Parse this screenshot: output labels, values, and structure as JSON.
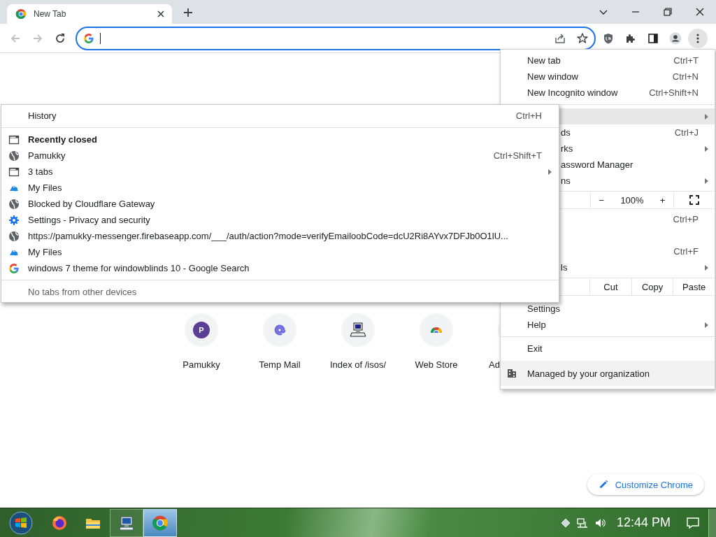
{
  "tab_strip": {
    "tabs": [
      {
        "title": "New Tab",
        "selected": true
      }
    ]
  },
  "toolbar": {
    "nav_buttons": [
      {
        "kind": "back",
        "disabled": true
      },
      {
        "kind": "forward",
        "disabled": true
      },
      {
        "kind": "reload",
        "disabled": false
      }
    ],
    "omnibox": {
      "focused": true
    },
    "actions": [
      {
        "kind": "shield",
        "pressed": false
      },
      {
        "kind": "puzzle",
        "pressed": false
      },
      {
        "kind": "side_panel",
        "pressed": false
      },
      {
        "kind": "profile",
        "pressed": false
      },
      {
        "kind": "menu",
        "pressed": true
      }
    ]
  },
  "shortcuts": [
    {
      "title": "Pamukky",
      "kind": "letter",
      "initial": "P"
    },
    {
      "title": "Temp Mail",
      "kind": "at"
    },
    {
      "title": "Index of /isos/",
      "kind": "computer"
    },
    {
      "title": "Web Store",
      "kind": "store"
    },
    {
      "title": "Ad",
      "kind": "covered"
    }
  ],
  "customize_button": {
    "label": "Customize Chrome"
  },
  "main_menu": {
    "items": [
      {
        "kind": "item",
        "label": "New tab",
        "shortcut": "Ctrl+T"
      },
      {
        "kind": "item",
        "label": "New window",
        "shortcut": "Ctrl+N"
      },
      {
        "kind": "item",
        "label": "New Incognito window",
        "shortcut": "Ctrl+Shift+N"
      },
      {
        "kind": "separator"
      },
      {
        "kind": "item",
        "submenu": true,
        "highlighted": true
      },
      {
        "kind": "item",
        "label": "ds",
        "partly_hidden": true,
        "shortcut": "Ctrl+J"
      },
      {
        "kind": "item",
        "label": "rks",
        "partly_hidden": true,
        "submenu": true
      },
      {
        "kind": "item",
        "label": "assword Manager",
        "partly_hidden": true
      },
      {
        "kind": "item",
        "label": "ns",
        "partly_hidden": true,
        "submenu": true
      },
      {
        "kind": "zoom",
        "minus": "−",
        "value": "100%",
        "plus": "+"
      },
      {
        "kind": "item",
        "shortcut": "Ctrl+P"
      },
      {
        "kind": "item"
      },
      {
        "kind": "item",
        "shortcut": "Ctrl+F"
      },
      {
        "kind": "item",
        "label": "ls",
        "partly_hidden": true,
        "submenu": true
      },
      {
        "kind": "edit",
        "cut": "Cut",
        "copy": "Copy",
        "paste": "Paste"
      },
      {
        "kind": "item",
        "label": "Settings"
      },
      {
        "kind": "item",
        "label": "Help",
        "submenu": true
      },
      {
        "kind": "separator"
      },
      {
        "kind": "item",
        "label": "Exit"
      },
      {
        "kind": "managed",
        "label": "Managed by your organization"
      }
    ]
  },
  "history_menu": {
    "header": {
      "label": "History",
      "shortcut": "Ctrl+H"
    },
    "items": [
      {
        "kind": "section",
        "label": "Recently closed"
      },
      {
        "kind": "page",
        "label": "Pamukky",
        "shortcut": "Ctrl+Shift+T"
      },
      {
        "kind": "group",
        "label": "3 tabs",
        "submenu": true
      },
      {
        "kind": "drive",
        "label": "My Files"
      },
      {
        "kind": "page",
        "label": "Blocked by Cloudflare Gateway"
      },
      {
        "kind": "settings",
        "label": "Settings - Privacy and security"
      },
      {
        "kind": "page",
        "label": "https://pamukky-messenger.firebaseapp.com/___/auth/action?mode=verifyEmailoobCode=dcU2Ri8AYvx7DFJb0O1lU..."
      },
      {
        "kind": "drive",
        "label": "My Files"
      },
      {
        "kind": "search",
        "label": "windows 7 theme for windowblinds 10 - Google Search"
      }
    ],
    "footer": "No tabs from other devices"
  },
  "taskbar": {
    "apps": [
      {
        "kind": "firefox",
        "running": false,
        "selected": false
      },
      {
        "kind": "folder",
        "running": false,
        "selected": false
      },
      {
        "kind": "computer",
        "running": true,
        "selected": false
      },
      {
        "kind": "chrome",
        "running": true,
        "selected": true
      }
    ],
    "tray": {
      "clock": "12:44 PM"
    }
  }
}
